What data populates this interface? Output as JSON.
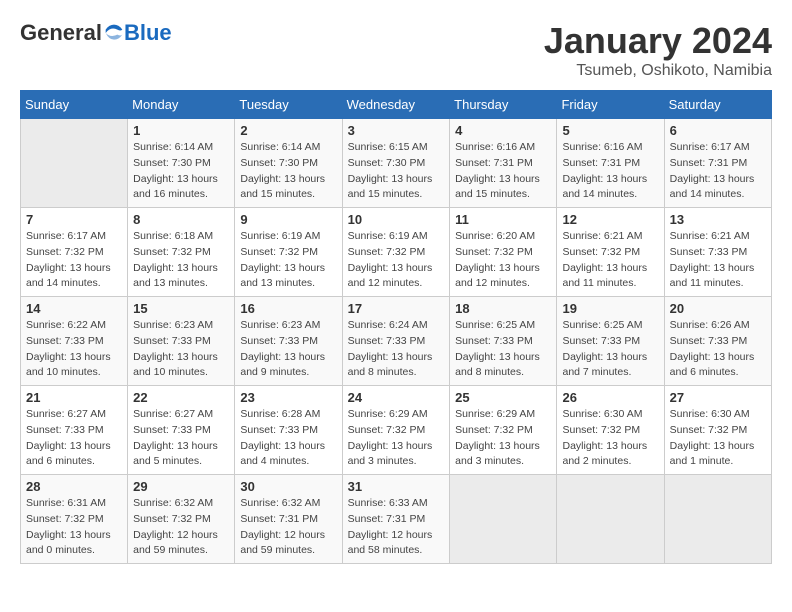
{
  "logo": {
    "general": "General",
    "blue": "Blue"
  },
  "title": "January 2024",
  "subtitle": "Tsumeb, Oshikoto, Namibia",
  "headers": [
    "Sunday",
    "Monday",
    "Tuesday",
    "Wednesday",
    "Thursday",
    "Friday",
    "Saturday"
  ],
  "weeks": [
    [
      {
        "num": "",
        "info": ""
      },
      {
        "num": "1",
        "info": "Sunrise: 6:14 AM\nSunset: 7:30 PM\nDaylight: 13 hours\nand 16 minutes."
      },
      {
        "num": "2",
        "info": "Sunrise: 6:14 AM\nSunset: 7:30 PM\nDaylight: 13 hours\nand 15 minutes."
      },
      {
        "num": "3",
        "info": "Sunrise: 6:15 AM\nSunset: 7:30 PM\nDaylight: 13 hours\nand 15 minutes."
      },
      {
        "num": "4",
        "info": "Sunrise: 6:16 AM\nSunset: 7:31 PM\nDaylight: 13 hours\nand 15 minutes."
      },
      {
        "num": "5",
        "info": "Sunrise: 6:16 AM\nSunset: 7:31 PM\nDaylight: 13 hours\nand 14 minutes."
      },
      {
        "num": "6",
        "info": "Sunrise: 6:17 AM\nSunset: 7:31 PM\nDaylight: 13 hours\nand 14 minutes."
      }
    ],
    [
      {
        "num": "7",
        "info": "Sunrise: 6:17 AM\nSunset: 7:32 PM\nDaylight: 13 hours\nand 14 minutes."
      },
      {
        "num": "8",
        "info": "Sunrise: 6:18 AM\nSunset: 7:32 PM\nDaylight: 13 hours\nand 13 minutes."
      },
      {
        "num": "9",
        "info": "Sunrise: 6:19 AM\nSunset: 7:32 PM\nDaylight: 13 hours\nand 13 minutes."
      },
      {
        "num": "10",
        "info": "Sunrise: 6:19 AM\nSunset: 7:32 PM\nDaylight: 13 hours\nand 12 minutes."
      },
      {
        "num": "11",
        "info": "Sunrise: 6:20 AM\nSunset: 7:32 PM\nDaylight: 13 hours\nand 12 minutes."
      },
      {
        "num": "12",
        "info": "Sunrise: 6:21 AM\nSunset: 7:32 PM\nDaylight: 13 hours\nand 11 minutes."
      },
      {
        "num": "13",
        "info": "Sunrise: 6:21 AM\nSunset: 7:33 PM\nDaylight: 13 hours\nand 11 minutes."
      }
    ],
    [
      {
        "num": "14",
        "info": "Sunrise: 6:22 AM\nSunset: 7:33 PM\nDaylight: 13 hours\nand 10 minutes."
      },
      {
        "num": "15",
        "info": "Sunrise: 6:23 AM\nSunset: 7:33 PM\nDaylight: 13 hours\nand 10 minutes."
      },
      {
        "num": "16",
        "info": "Sunrise: 6:23 AM\nSunset: 7:33 PM\nDaylight: 13 hours\nand 9 minutes."
      },
      {
        "num": "17",
        "info": "Sunrise: 6:24 AM\nSunset: 7:33 PM\nDaylight: 13 hours\nand 8 minutes."
      },
      {
        "num": "18",
        "info": "Sunrise: 6:25 AM\nSunset: 7:33 PM\nDaylight: 13 hours\nand 8 minutes."
      },
      {
        "num": "19",
        "info": "Sunrise: 6:25 AM\nSunset: 7:33 PM\nDaylight: 13 hours\nand 7 minutes."
      },
      {
        "num": "20",
        "info": "Sunrise: 6:26 AM\nSunset: 7:33 PM\nDaylight: 13 hours\nand 6 minutes."
      }
    ],
    [
      {
        "num": "21",
        "info": "Sunrise: 6:27 AM\nSunset: 7:33 PM\nDaylight: 13 hours\nand 6 minutes."
      },
      {
        "num": "22",
        "info": "Sunrise: 6:27 AM\nSunset: 7:33 PM\nDaylight: 13 hours\nand 5 minutes."
      },
      {
        "num": "23",
        "info": "Sunrise: 6:28 AM\nSunset: 7:33 PM\nDaylight: 13 hours\nand 4 minutes."
      },
      {
        "num": "24",
        "info": "Sunrise: 6:29 AM\nSunset: 7:32 PM\nDaylight: 13 hours\nand 3 minutes."
      },
      {
        "num": "25",
        "info": "Sunrise: 6:29 AM\nSunset: 7:32 PM\nDaylight: 13 hours\nand 3 minutes."
      },
      {
        "num": "26",
        "info": "Sunrise: 6:30 AM\nSunset: 7:32 PM\nDaylight: 13 hours\nand 2 minutes."
      },
      {
        "num": "27",
        "info": "Sunrise: 6:30 AM\nSunset: 7:32 PM\nDaylight: 13 hours\nand 1 minute."
      }
    ],
    [
      {
        "num": "28",
        "info": "Sunrise: 6:31 AM\nSunset: 7:32 PM\nDaylight: 13 hours\nand 0 minutes."
      },
      {
        "num": "29",
        "info": "Sunrise: 6:32 AM\nSunset: 7:32 PM\nDaylight: 12 hours\nand 59 minutes."
      },
      {
        "num": "30",
        "info": "Sunrise: 6:32 AM\nSunset: 7:31 PM\nDaylight: 12 hours\nand 59 minutes."
      },
      {
        "num": "31",
        "info": "Sunrise: 6:33 AM\nSunset: 7:31 PM\nDaylight: 12 hours\nand 58 minutes."
      },
      {
        "num": "",
        "info": ""
      },
      {
        "num": "",
        "info": ""
      },
      {
        "num": "",
        "info": ""
      }
    ]
  ]
}
